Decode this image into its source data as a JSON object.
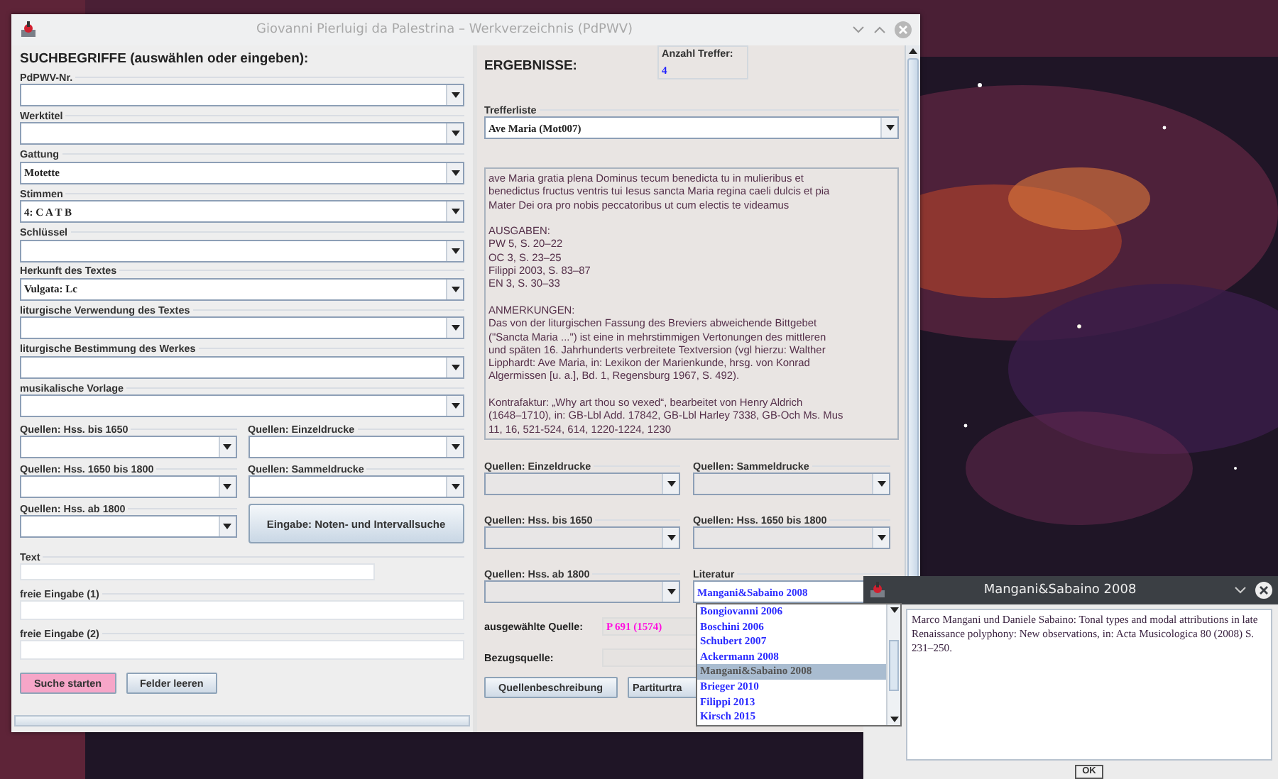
{
  "window": {
    "title": "Giovanni Pierluigi da Palestrina – Werkverzeichnis (PdPWV)"
  },
  "search": {
    "heading": "SUCHBEGRIFFE (auswählen oder eingeben):",
    "combos": [
      {
        "label": "PdPWV-Nr."
      },
      {
        "label": "Werktitel"
      },
      {
        "label": "Gattung",
        "value": "Motette"
      },
      {
        "label": "Stimmen",
        "value": "4: C A T B"
      },
      {
        "label": "Schlüssel"
      },
      {
        "label": "Herkunft des Textes",
        "value": "Vulgata: Lc"
      },
      {
        "label": "liturgische Verwendung des Textes"
      },
      {
        "label": "liturgische Bestimmung des Werkes"
      },
      {
        "label": "musikalische Vorlage"
      }
    ],
    "source_combos": [
      {
        "label": "Quellen: Hss. bis 1650"
      },
      {
        "label": "Quellen: Einzeldrucke"
      },
      {
        "label": "Quellen: Hss. 1650 bis 1800"
      },
      {
        "label": "Quellen: Sammeldrucke"
      },
      {
        "label": "Quellen: Hss. ab 1800"
      }
    ],
    "melody_button": "Eingabe: Noten- und Intervallsuche",
    "text_fields": [
      {
        "label": "Text",
        "kind": "short"
      },
      {
        "label": "freie Eingabe (1)",
        "kind": "wide"
      },
      {
        "label": "freie Eingabe (2)",
        "kind": "wide"
      }
    ],
    "buttons": [
      {
        "label": "Suche starten",
        "kind": "primary"
      },
      {
        "label": "Felder leeren",
        "kind": "normal"
      }
    ]
  },
  "results": {
    "heading": "ERGEBNISSE:",
    "hit_count": {
      "label": "Anzahl Treffer:",
      "value": "4"
    },
    "hit_list": {
      "label": "Trefferliste",
      "value": "Ave Maria (Mot007)"
    },
    "description": [
      {
        "lines": [
          "ave Maria gratia plena Dominus tecum benedicta tu in mulieribus et",
          "benedictus fructus ventris tui Iesus sancta Maria regina caeli dulcis et pia",
          "Mater Dei ora pro nobis peccatoribus ut cum electis te videamus"
        ]
      },
      {
        "lines": [
          "AUSGABEN:",
          "PW 5, S. 20–22",
          "OC 3, S. 23–25",
          "Filippi 2003, S. 83–87",
          "EN 3, S. 30–33"
        ]
      },
      {
        "lines": [
          "ANMERKUNGEN:",
          "Das von der liturgischen Fassung des Breviers abweichende Bittgebet",
          "(\"Sancta Maria ...\") ist eine in mehrstimmigen Vertonungen des mittleren",
          "und späten 16. Jahrhunderts verbreitete Textversion (vgl hierzu: Walther",
          "Lipphardt: Ave Maria, in: Lexikon der Marienkunde, hrsg. von Konrad",
          "Algermissen [u. a.], Bd. 1, Regensburg 1967, S. 492)."
        ]
      },
      {
        "lines": [
          "Kontrafaktur: „Why art thou so vexed“, bearbeitet von Henry Aldrich",
          "(1648–1710), in: GB-Lbl Add. 17842, GB-Lbl Harley 7338, GB-Och Ms. Mus",
          "11, 16, 521-524, 614, 1220-1224, 1230"
        ]
      }
    ],
    "source_combos": [
      {
        "label": "Quellen: Einzeldrucke"
      },
      {
        "label": "Quellen: Sammeldrucke"
      },
      {
        "label": "Quellen: Hss. bis 1650"
      },
      {
        "label": "Quellen: Hss. 1650 bis 1800"
      },
      {
        "label": "Quellen: Hss. ab 1800"
      },
      {
        "label": "Literatur",
        "value": "Mangani&Sabaino 2008"
      }
    ],
    "literature_list": [
      {
        "label": "Bongiovanni 2006",
        "selected": false
      },
      {
        "label": "Boschini 2006",
        "selected": false
      },
      {
        "label": "Schubert 2007",
        "selected": false
      },
      {
        "label": "Ackermann 2008",
        "selected": false
      },
      {
        "label": "Mangani&Sabaino 2008",
        "selected": true
      },
      {
        "label": "Brieger 2010",
        "selected": false
      },
      {
        "label": "Filippi 2013",
        "selected": false
      },
      {
        "label": "Kirsch 2015",
        "selected": false
      }
    ],
    "selected_source": {
      "label": "ausgewählte Quelle:",
      "value": "P 691 (1574)"
    },
    "reference_source": {
      "label": "Bezugsquelle:"
    },
    "buttons": [
      "Quellenbeschreibung",
      "Partiturtra"
    ]
  },
  "dialog": {
    "title": "Mangani&Sabaino 2008",
    "body": "Marco Mangani und Daniele Sabaino: Tonal types and modal attributions in late Renaissance polyphony: New observations, in: Acta Musicologica 80 (2008) S. 231–250.",
    "button": "OK"
  }
}
